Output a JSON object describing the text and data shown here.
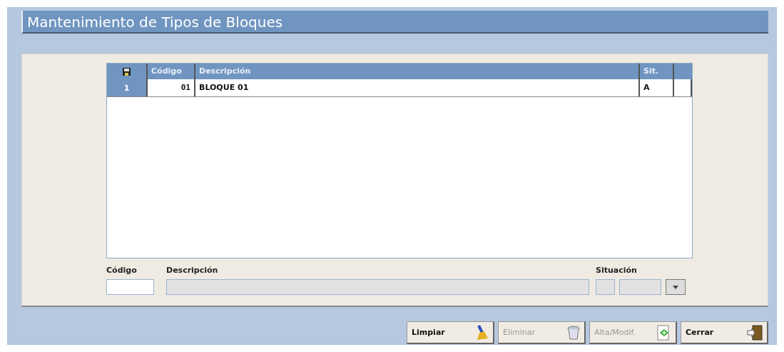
{
  "window": {
    "title": "Mantenimiento de Tipos de Bloques"
  },
  "table": {
    "columns": [
      "Código",
      "Descripción",
      "Sit."
    ],
    "rows": [
      {
        "number": "1",
        "codigo": "01",
        "descripcion": "BLOQUE 01",
        "sit": "A"
      }
    ]
  },
  "form": {
    "fields": [
      {
        "kind": "text",
        "label": "Código",
        "disabled": false
      },
      {
        "kind": "text",
        "label": "Descripción",
        "disabled": true
      },
      {
        "kind": "select",
        "label": "Situación",
        "disabled": true
      }
    ]
  },
  "buttons": [
    {
      "label": "Limpiar",
      "kind": "clear",
      "disabled": false
    },
    {
      "label": "Eliminar",
      "kind": "delete",
      "disabled": true
    },
    {
      "label": "Alta/Modif.",
      "kind": "save",
      "disabled": true
    },
    {
      "label": "Cerrar",
      "kind": "close",
      "disabled": false
    }
  ]
}
